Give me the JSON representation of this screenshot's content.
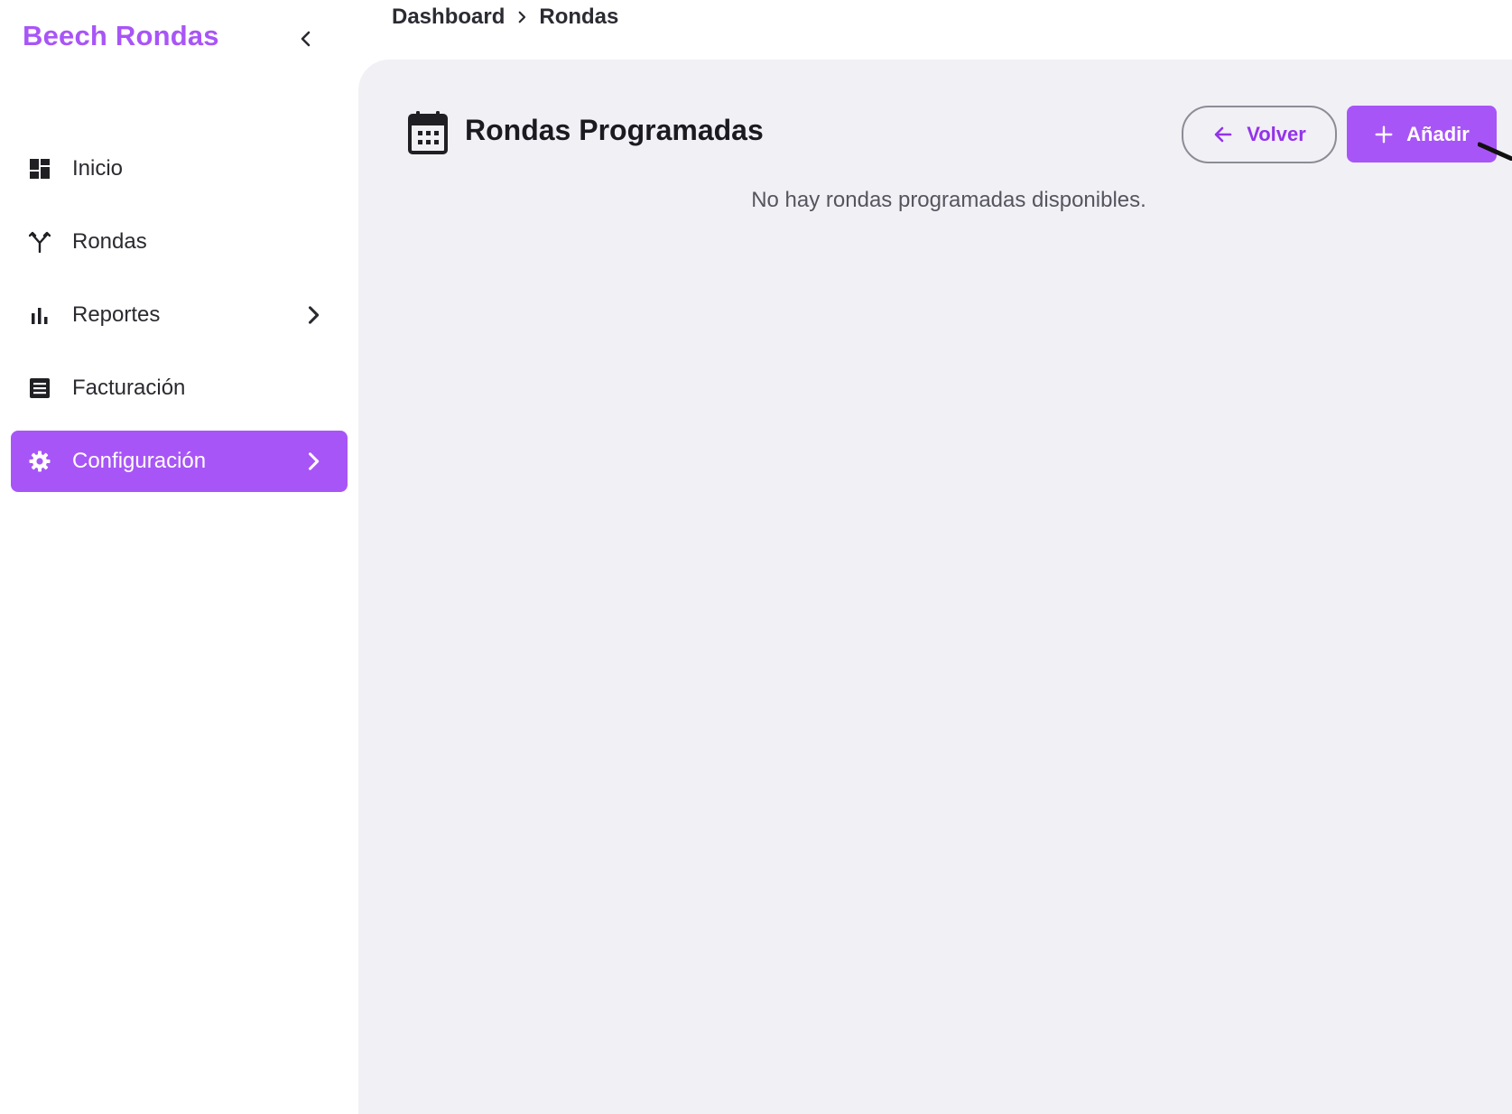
{
  "sidebar": {
    "brand": "Beech Rondas",
    "items": [
      {
        "label": "Inicio",
        "icon": "dashboard-icon",
        "active": false,
        "has_submenu": false
      },
      {
        "label": "Rondas",
        "icon": "fork-icon",
        "active": false,
        "has_submenu": false
      },
      {
        "label": "Reportes",
        "icon": "bar-chart-icon",
        "active": false,
        "has_submenu": true
      },
      {
        "label": "Facturación",
        "icon": "invoice-icon",
        "active": false,
        "has_submenu": false
      },
      {
        "label": "Configuración",
        "icon": "gear-icon",
        "active": true,
        "has_submenu": true
      }
    ]
  },
  "breadcrumb": {
    "items": [
      "Dashboard",
      "Rondas"
    ]
  },
  "main": {
    "title": "Rondas Programadas",
    "title_icon": "calendar-icon",
    "back_label": "Volver",
    "add_label": "Añadir",
    "empty_message": "No hay rondas programadas disponibles."
  },
  "colors": {
    "accent": "#a855f7",
    "panel_bg": "#f1f0f5"
  }
}
